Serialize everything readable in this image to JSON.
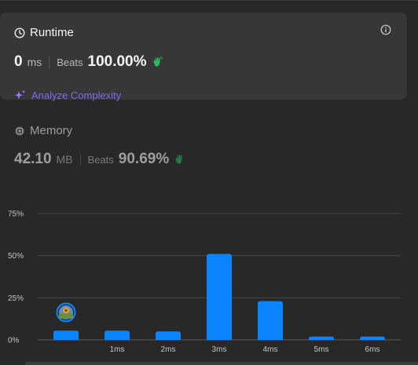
{
  "runtime": {
    "title": "Runtime",
    "value": "0",
    "unit": "ms",
    "beats_label": "Beats",
    "beats_value": "100.00%",
    "analyze_label": "Analyze Complexity"
  },
  "memory": {
    "title": "Memory",
    "value": "42.10",
    "unit": "MB",
    "beats_label": "Beats",
    "beats_value": "90.69%"
  },
  "colors": {
    "bar": "#0a84ff",
    "accent_purple": "#7b6df2",
    "beats_green": "#2cbb5d"
  },
  "chart_data": {
    "type": "bar",
    "categories": [
      "",
      "1ms",
      "2ms",
      "3ms",
      "4ms",
      "5ms",
      "6ms"
    ],
    "values": [
      5.5,
      5.5,
      5,
      51,
      23,
      2,
      2
    ],
    "y_ticks": [
      "0%",
      "25%",
      "50%",
      "75%"
    ],
    "ylim": [
      0,
      75
    ],
    "grid": true,
    "highlighted_category_index": 0
  }
}
